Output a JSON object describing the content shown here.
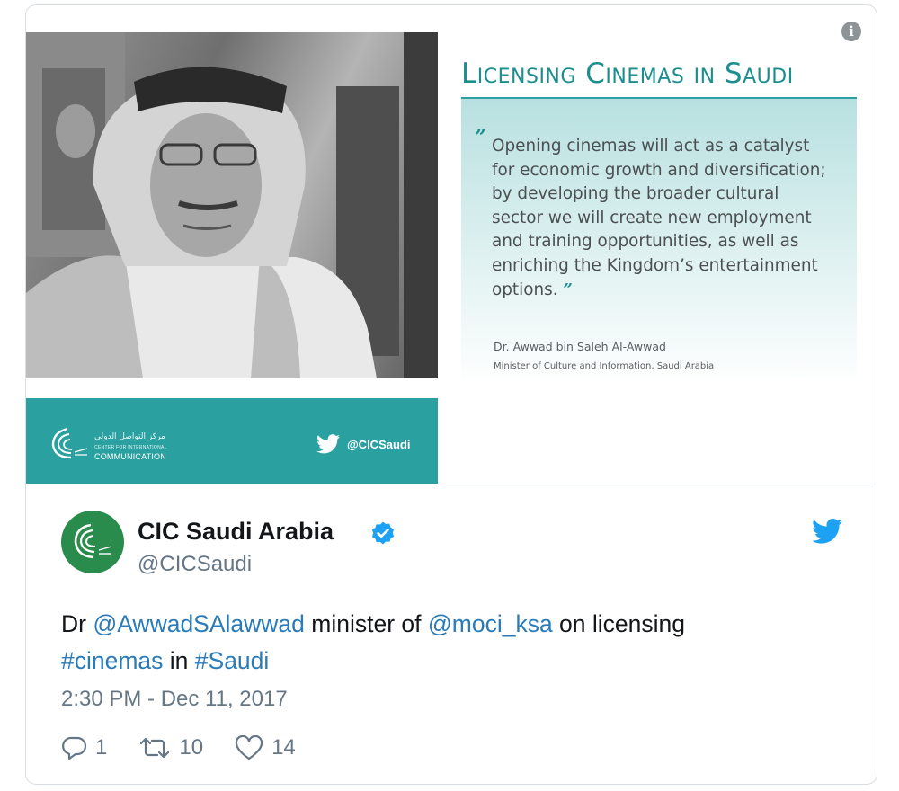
{
  "media": {
    "headline": "Licensing Cinemas in Saudi",
    "quote_lines": "Opening cinemas will act as a catalyst\nfor economic growth and diversification;\nby developing the broader cultural\nsector we will create new employment\nand training opportunities, as well as\nenriching the Kingdom’s entertainment\noptions.",
    "quote_open_mark": "”",
    "quote_close_mark": "”",
    "author_name": "Dr. Awwad bin Saleh Al-Awwad",
    "author_title": "Minister of Culture and Information, Saudi Arabia",
    "brand_arabic": "مركز التواصل الدولي",
    "brand_small": "CENTER FOR INTERNATIONAL",
    "brand_name": "COMMUNICATION",
    "band_handle": "@CICSaudi",
    "info_glyph": "i"
  },
  "tweet": {
    "display_name": "CIC Saudi Arabia",
    "handle": "@CICSaudi",
    "text_parts": {
      "p1": "Dr ",
      "mention1": "@AwwadSAlawwad",
      "p2": " minister of ",
      "mention2": "@moci_ksa",
      "p3": " on licensing",
      "hashtag1": "#cinemas",
      "p4": " in ",
      "hashtag2": "#Saudi"
    },
    "timestamp": "2:30 PM - Dec 11, 2017",
    "replies": "1",
    "retweets": "10",
    "likes": "14"
  },
  "colors": {
    "teal": "#2aa0a0",
    "link": "#2b7bb9",
    "verified": "#1da1f2",
    "avatar": "#2a8c4c"
  }
}
